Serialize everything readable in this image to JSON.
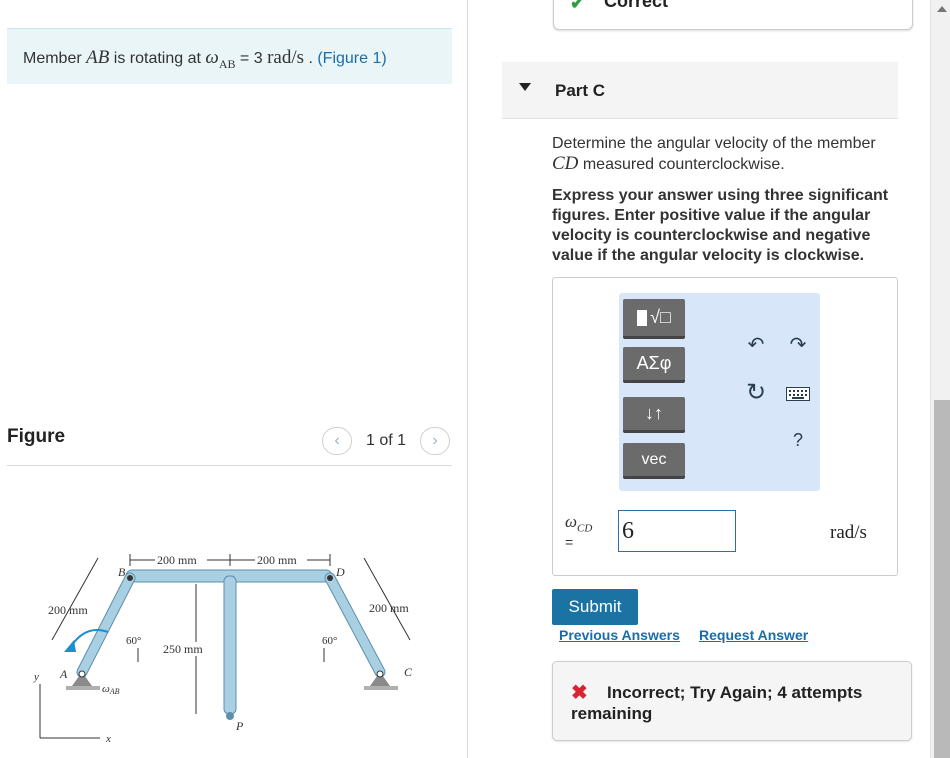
{
  "problem": {
    "prefix": "Member ",
    "member": "AB",
    "middle": " is rotating at ",
    "omega": "ω",
    "omega_sub": "AB",
    "equals": " = 3 ",
    "unit": "rad/s",
    "period": " . ",
    "figure_link": "(Figure 1)"
  },
  "figure": {
    "title": "Figure",
    "page_label": "1 of 1",
    "prev_icon": "chevron-left-icon",
    "next_icon": "chevron-right-icon",
    "labels": {
      "b": "B",
      "d": "D",
      "a": "A",
      "c": "C",
      "p": "P",
      "y": "y",
      "x": "x",
      "dim_200_left_top": "200 mm",
      "dim_200_right_top": "200 mm",
      "dim_200_left_side": "200 mm",
      "dim_200_right_side": "200 mm",
      "dim_250": "250 mm",
      "angle_left": "60°",
      "angle_right": "60°",
      "omega_ab": "ω",
      "omega_ab_sub": "AB"
    }
  },
  "status": {
    "correct_label": "Correct",
    "check_icon": "check-icon"
  },
  "part": {
    "title": "Part C",
    "question_prefix": "Determine the angular velocity of the member ",
    "question_member": "CD",
    "question_suffix": " measured counterclockwise.",
    "instructions": "Express your answer using three significant figures. Enter positive value if the angular velocity is counterclockwise and negative value if the angular velocity is clockwise."
  },
  "toolbar": {
    "templates_label": "√□",
    "greek_label": "ΑΣφ",
    "arrows_label": "↓↑",
    "vec_label": "vec",
    "undo_icon": "undo-icon",
    "redo_icon": "redo-icon",
    "reset_icon": "reset-icon",
    "keyboard_icon": "keyboard-icon",
    "help_label": "?"
  },
  "answer": {
    "var_symbol": "ω",
    "var_sub": "CD",
    "equals": "=",
    "value": "6",
    "unit": "rad/s"
  },
  "actions": {
    "submit_label": "Submit",
    "previous_answers": "Previous Answers",
    "request_answer": "Request Answer"
  },
  "feedback": {
    "icon": "x-icon",
    "text": "Incorrect; Try Again; 4 attempts remaining"
  },
  "colors": {
    "accent": "#1a73a3",
    "link": "#1a6ea8",
    "correct": "#2f9e44",
    "incorrect": "#d9232e",
    "problem_bg": "#eaf5f8",
    "toolbar_bg": "#d7e7f9",
    "member_fill": "#a9cfe3"
  }
}
